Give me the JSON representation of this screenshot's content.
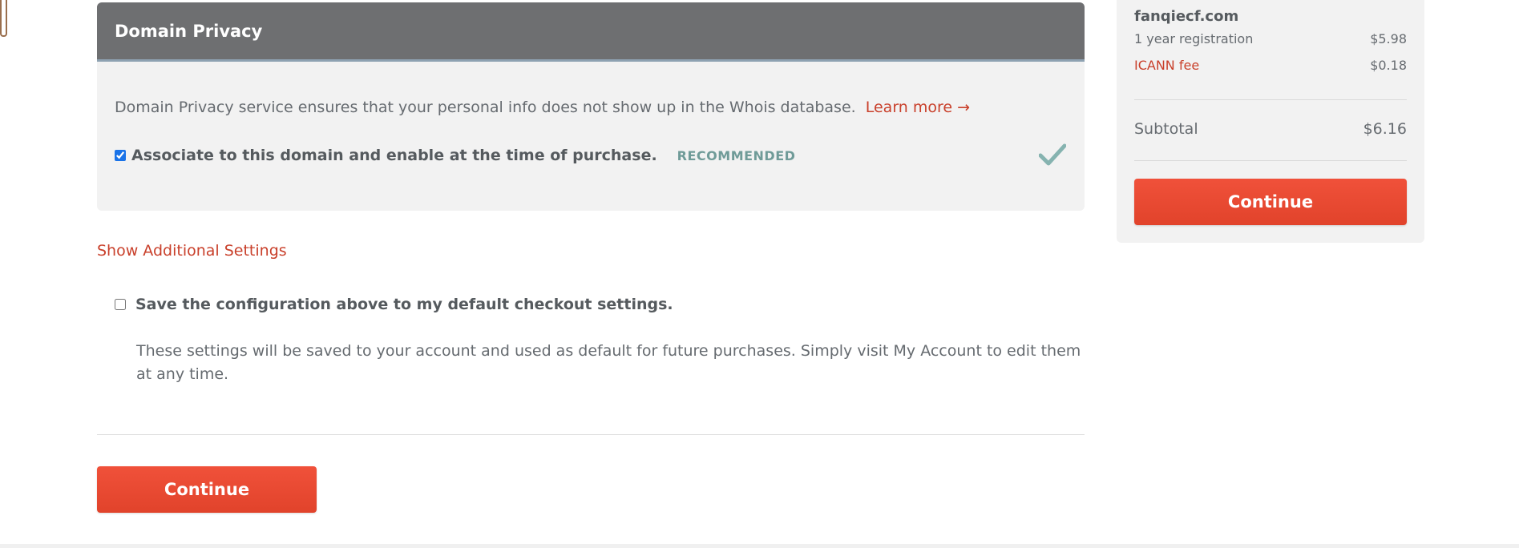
{
  "privacy": {
    "title": "Domain Privacy",
    "description": "Domain Privacy service ensures that your personal info does not show up in the Whois database.",
    "learn_more": "Learn more →",
    "associate_label": "Associate to this domain and enable at the time of purchase.",
    "associate_checked": true,
    "recommended_badge": "RECOMMENDED",
    "check_icon": "check-icon"
  },
  "settings": {
    "show_additional": "Show Additional Settings",
    "save_label": "Save the configuration above to my default checkout settings.",
    "save_checked": false,
    "save_help": "These settings will be saved to your account and used as default for future purchases. Simply visit My Account to edit them at any time."
  },
  "actions": {
    "continue_label": "Continue"
  },
  "summary": {
    "domain": "fanqiecf.com",
    "items": [
      {
        "label": "1 year registration",
        "amount": "$5.98"
      },
      {
        "label": "ICANN fee",
        "amount": "$0.18"
      }
    ],
    "subtotal_label": "Subtotal",
    "subtotal_amount": "$6.16",
    "continue_label": "Continue"
  },
  "colors": {
    "accent": "#e84a31",
    "link": "#c9402b",
    "header": "#6e6f71",
    "recommended": "#6f9b98"
  }
}
